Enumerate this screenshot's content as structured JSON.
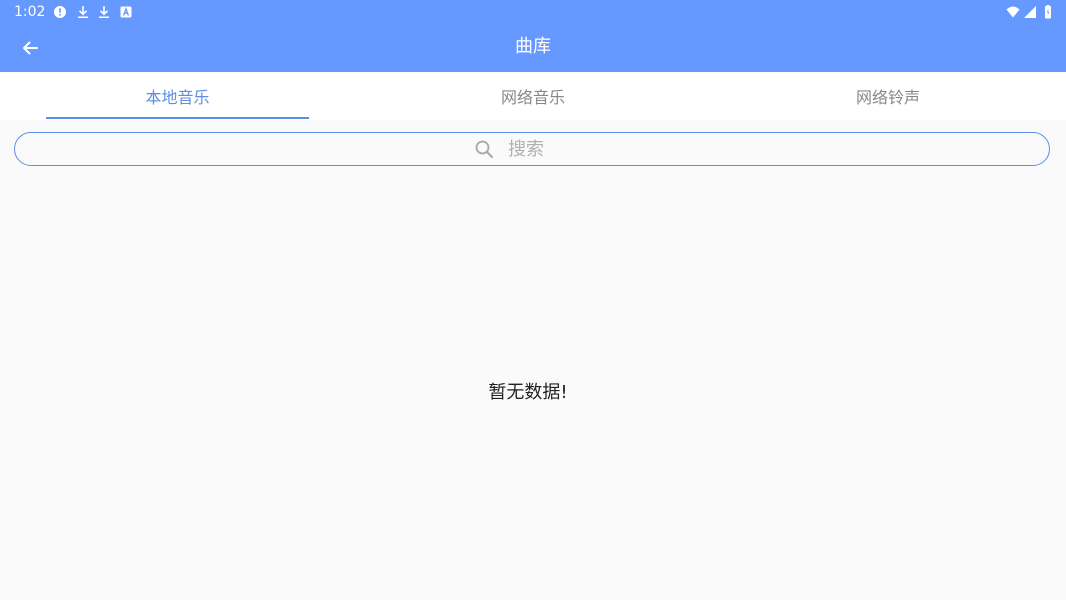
{
  "status_bar": {
    "time": "1:02",
    "icons": [
      "alert-circle-icon",
      "download-icon",
      "download-icon",
      "a-box-icon"
    ],
    "right_icons": [
      "wifi-icon",
      "signal-icon",
      "battery-icon"
    ]
  },
  "toolbar": {
    "title": "曲库",
    "back_icon": "arrow-left-icon"
  },
  "tabs": [
    {
      "label": "本地音乐",
      "active": true
    },
    {
      "label": "网络音乐",
      "active": false
    },
    {
      "label": "网络铃声",
      "active": false
    }
  ],
  "search": {
    "placeholder": "搜索",
    "value": ""
  },
  "empty_state": {
    "message": "暂无数据!"
  },
  "colors": {
    "primary": "#6699ff",
    "accent": "#5b8ee6",
    "background": "#fafafa"
  }
}
